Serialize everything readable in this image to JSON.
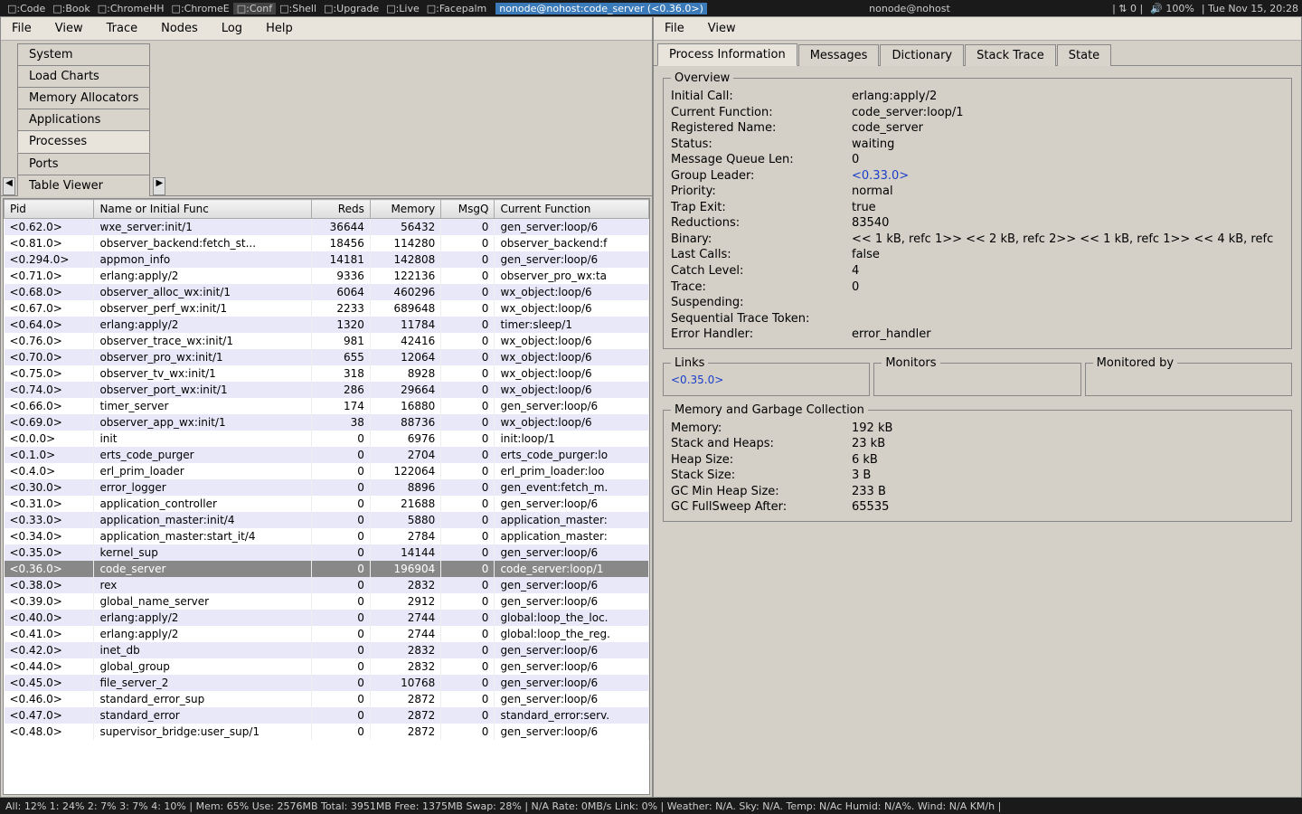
{
  "taskbar": {
    "items": [
      {
        "label": ":Code"
      },
      {
        "label": ":Book"
      },
      {
        "label": ":ChromeHH"
      },
      {
        "label": ":ChromeE"
      },
      {
        "label": ":Conf",
        "active": true
      },
      {
        "label": ":Shell"
      },
      {
        "label": ":Upgrade"
      },
      {
        "label": ":Live"
      },
      {
        "label": ":Facepalm"
      }
    ],
    "window_title": "nonode@nohost:code_server (<0.36.0>)",
    "second_window": "nonode@nohost",
    "right": {
      "net": "0 |",
      "vol": "100%",
      "clock": "Tue Nov 15, 20:28"
    }
  },
  "left_menu": [
    "File",
    "View",
    "Trace",
    "Nodes",
    "Log",
    "Help"
  ],
  "left_tabs": [
    "System",
    "Load Charts",
    "Memory Allocators",
    "Applications",
    "Processes",
    "Ports",
    "Table Viewer"
  ],
  "left_tab_active": 4,
  "columns": [
    "Pid",
    "Name or Initial Func",
    "Reds",
    "Memory",
    "MsgQ",
    "Current Function"
  ],
  "rows": [
    {
      "pid": "<0.62.0>",
      "name": "wxe_server:init/1",
      "reds": 36644,
      "mem": 56432,
      "msgq": 0,
      "func": "gen_server:loop/6"
    },
    {
      "pid": "<0.81.0>",
      "name": "observer_backend:fetch_st...",
      "reds": 18456,
      "mem": 114280,
      "msgq": 0,
      "func": "observer_backend:f"
    },
    {
      "pid": "<0.294.0>",
      "name": "appmon_info",
      "reds": 14181,
      "mem": 142808,
      "msgq": 0,
      "func": "gen_server:loop/6"
    },
    {
      "pid": "<0.71.0>",
      "name": "erlang:apply/2",
      "reds": 9336,
      "mem": 122136,
      "msgq": 0,
      "func": "observer_pro_wx:ta"
    },
    {
      "pid": "<0.68.0>",
      "name": "observer_alloc_wx:init/1",
      "reds": 6064,
      "mem": 460296,
      "msgq": 0,
      "func": "wx_object:loop/6"
    },
    {
      "pid": "<0.67.0>",
      "name": "observer_perf_wx:init/1",
      "reds": 2233,
      "mem": 689648,
      "msgq": 0,
      "func": "wx_object:loop/6"
    },
    {
      "pid": "<0.64.0>",
      "name": "erlang:apply/2",
      "reds": 1320,
      "mem": 11784,
      "msgq": 0,
      "func": "timer:sleep/1"
    },
    {
      "pid": "<0.76.0>",
      "name": "observer_trace_wx:init/1",
      "reds": 981,
      "mem": 42416,
      "msgq": 0,
      "func": "wx_object:loop/6"
    },
    {
      "pid": "<0.70.0>",
      "name": "observer_pro_wx:init/1",
      "reds": 655,
      "mem": 12064,
      "msgq": 0,
      "func": "wx_object:loop/6"
    },
    {
      "pid": "<0.75.0>",
      "name": "observer_tv_wx:init/1",
      "reds": 318,
      "mem": 8928,
      "msgq": 0,
      "func": "wx_object:loop/6"
    },
    {
      "pid": "<0.74.0>",
      "name": "observer_port_wx:init/1",
      "reds": 286,
      "mem": 29664,
      "msgq": 0,
      "func": "wx_object:loop/6"
    },
    {
      "pid": "<0.66.0>",
      "name": "timer_server",
      "reds": 174,
      "mem": 16880,
      "msgq": 0,
      "func": "gen_server:loop/6"
    },
    {
      "pid": "<0.69.0>",
      "name": "observer_app_wx:init/1",
      "reds": 38,
      "mem": 88736,
      "msgq": 0,
      "func": "wx_object:loop/6"
    },
    {
      "pid": "<0.0.0>",
      "name": "init",
      "reds": 0,
      "mem": 6976,
      "msgq": 0,
      "func": "init:loop/1"
    },
    {
      "pid": "<0.1.0>",
      "name": "erts_code_purger",
      "reds": 0,
      "mem": 2704,
      "msgq": 0,
      "func": "erts_code_purger:lo"
    },
    {
      "pid": "<0.4.0>",
      "name": "erl_prim_loader",
      "reds": 0,
      "mem": 122064,
      "msgq": 0,
      "func": "erl_prim_loader:loo"
    },
    {
      "pid": "<0.30.0>",
      "name": "error_logger",
      "reds": 0,
      "mem": 8896,
      "msgq": 0,
      "func": "gen_event:fetch_m."
    },
    {
      "pid": "<0.31.0>",
      "name": "application_controller",
      "reds": 0,
      "mem": 21688,
      "msgq": 0,
      "func": "gen_server:loop/6"
    },
    {
      "pid": "<0.33.0>",
      "name": "application_master:init/4",
      "reds": 0,
      "mem": 5880,
      "msgq": 0,
      "func": "application_master:"
    },
    {
      "pid": "<0.34.0>",
      "name": "application_master:start_it/4",
      "reds": 0,
      "mem": 2784,
      "msgq": 0,
      "func": "application_master:"
    },
    {
      "pid": "<0.35.0>",
      "name": "kernel_sup",
      "reds": 0,
      "mem": 14144,
      "msgq": 0,
      "func": "gen_server:loop/6"
    },
    {
      "pid": "<0.36.0>",
      "name": "code_server",
      "reds": 0,
      "mem": 196904,
      "msgq": 0,
      "func": "code_server:loop/1",
      "selected": true
    },
    {
      "pid": "<0.38.0>",
      "name": "rex",
      "reds": 0,
      "mem": 2832,
      "msgq": 0,
      "func": "gen_server:loop/6"
    },
    {
      "pid": "<0.39.0>",
      "name": "global_name_server",
      "reds": 0,
      "mem": 2912,
      "msgq": 0,
      "func": "gen_server:loop/6"
    },
    {
      "pid": "<0.40.0>",
      "name": "erlang:apply/2",
      "reds": 0,
      "mem": 2744,
      "msgq": 0,
      "func": "global:loop_the_loc."
    },
    {
      "pid": "<0.41.0>",
      "name": "erlang:apply/2",
      "reds": 0,
      "mem": 2744,
      "msgq": 0,
      "func": "global:loop_the_reg."
    },
    {
      "pid": "<0.42.0>",
      "name": "inet_db",
      "reds": 0,
      "mem": 2832,
      "msgq": 0,
      "func": "gen_server:loop/6"
    },
    {
      "pid": "<0.44.0>",
      "name": "global_group",
      "reds": 0,
      "mem": 2832,
      "msgq": 0,
      "func": "gen_server:loop/6"
    },
    {
      "pid": "<0.45.0>",
      "name": "file_server_2",
      "reds": 0,
      "mem": 10768,
      "msgq": 0,
      "func": "gen_server:loop/6"
    },
    {
      "pid": "<0.46.0>",
      "name": "standard_error_sup",
      "reds": 0,
      "mem": 2872,
      "msgq": 0,
      "func": "gen_server:loop/6"
    },
    {
      "pid": "<0.47.0>",
      "name": "standard_error",
      "reds": 0,
      "mem": 2872,
      "msgq": 0,
      "func": "standard_error:serv."
    },
    {
      "pid": "<0.48.0>",
      "name": "supervisor_bridge:user_sup/1",
      "reds": 0,
      "mem": 2872,
      "msgq": 0,
      "func": "gen_server:loop/6"
    }
  ],
  "right_menu": [
    "File",
    "View"
  ],
  "right_tabs": [
    "Process Information",
    "Messages",
    "Dictionary",
    "Stack Trace",
    "State"
  ],
  "right_tab_active": 0,
  "overview": {
    "title": "Overview",
    "items": [
      {
        "k": "Initial Call:",
        "v": "erlang:apply/2"
      },
      {
        "k": "Current Function:",
        "v": "code_server:loop/1"
      },
      {
        "k": "Registered Name:",
        "v": "code_server"
      },
      {
        "k": "Status:",
        "v": "waiting"
      },
      {
        "k": "Message Queue Len:",
        "v": "0"
      },
      {
        "k": "Group Leader:",
        "v": "<0.33.0>",
        "link": true
      },
      {
        "k": "Priority:",
        "v": "normal"
      },
      {
        "k": "Trap Exit:",
        "v": "true"
      },
      {
        "k": "Reductions:",
        "v": "83540"
      },
      {
        "k": "Binary:",
        "v": "<< 1 kB, refc 1>> << 2 kB, refc 2>> << 1 kB, refc 1>> << 4 kB, refc"
      },
      {
        "k": "Last Calls:",
        "v": "false"
      },
      {
        "k": "Catch Level:",
        "v": "4"
      },
      {
        "k": "Trace:",
        "v": "0"
      },
      {
        "k": "Suspending:",
        "v": ""
      },
      {
        "k": "Sequential Trace Token:",
        "v": ""
      },
      {
        "k": "Error Handler:",
        "v": "error_handler"
      }
    ]
  },
  "links": {
    "title": "Links",
    "value": "<0.35.0>"
  },
  "monitors": {
    "title": "Monitors"
  },
  "monitored_by": {
    "title": "Monitored by"
  },
  "memgc": {
    "title": "Memory and Garbage Collection",
    "items": [
      {
        "k": "Memory:",
        "v": "192 kB"
      },
      {
        "k": "Stack and Heaps:",
        "v": "23 kB"
      },
      {
        "k": "Heap Size:",
        "v": "6 kB"
      },
      {
        "k": "Stack Size:",
        "v": "3 B"
      },
      {
        "k": "GC Min Heap Size:",
        "v": "233 B"
      },
      {
        "k": "GC FullSweep After:",
        "v": "65535"
      }
    ]
  },
  "statusbar": "All: 12% 1: 24% 2: 7% 3: 7% 4: 10% |  Mem: 65% Use: 2576MB Total: 3951MB Free: 1375MB Swap: 28% |  N/A Rate: 0MB/s Link: 0% | Weather: N/A. Sky: N/A. Temp: N/Ac Humid: N/A%. Wind: N/A KM/h |"
}
